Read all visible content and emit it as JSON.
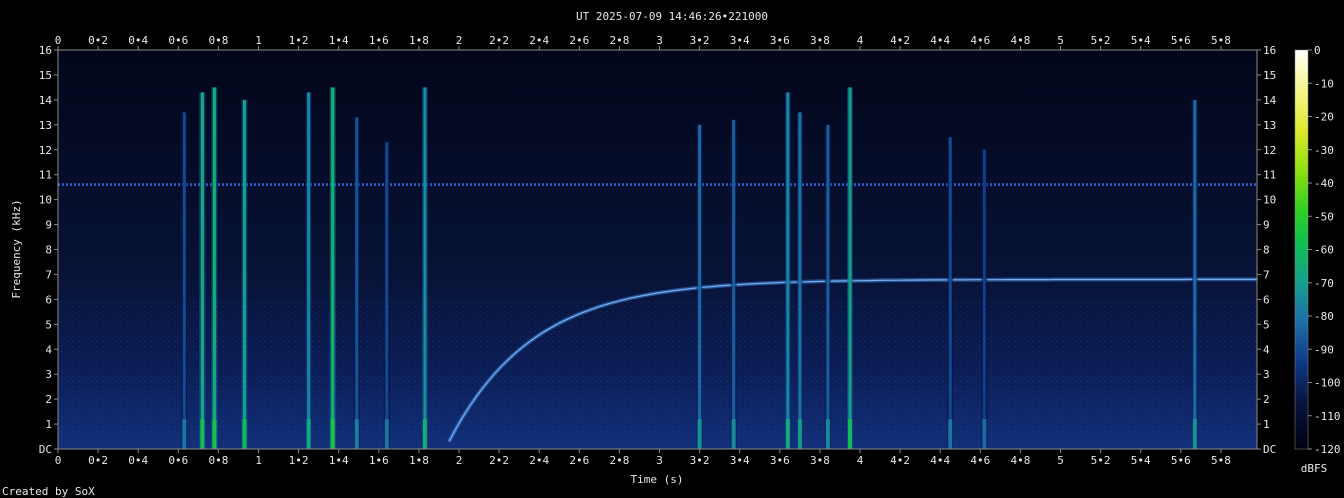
{
  "chart_data": {
    "type": "heatmap",
    "title": "UT 2025-07-09 14:46:26•221000",
    "xlabel": "Time (s)",
    "ylabel": "Frequency (kHz)",
    "xlim": [
      0,
      5.98
    ],
    "ylim": [
      0,
      16
    ],
    "x_ticks": [
      "0",
      "0•2",
      "0•4",
      "0•6",
      "0•8",
      "1",
      "1•2",
      "1•4",
      "1•6",
      "1•8",
      "2",
      "2•2",
      "2•4",
      "2•6",
      "2•8",
      "3",
      "3•2",
      "3•4",
      "3•6",
      "3•8",
      "4",
      "4•2",
      "4•4",
      "4•6",
      "4•8",
      "5",
      "5•2",
      "5•4",
      "5•6",
      "5•8"
    ],
    "y_ticks": [
      "DC",
      "1",
      "2",
      "3",
      "4",
      "5",
      "6",
      "7",
      "8",
      "9",
      "10",
      "11",
      "12",
      "13",
      "14",
      "15",
      "16"
    ],
    "colorbar": {
      "label": "dBFS",
      "ticks": [
        "0",
        "-10",
        "-20",
        "-30",
        "-40",
        "-50",
        "-60",
        "-70",
        "-80",
        "-90",
        "-100",
        "-110",
        "-120"
      ],
      "range": [
        -120,
        0
      ]
    },
    "features": {
      "tone_khz": 10.6,
      "sweep": {
        "start_s": 1.95,
        "end_s": 5.98,
        "start_khz": 0.3,
        "end_khz": 6.8
      },
      "clicks": [
        {
          "t": 0.63,
          "top_khz": 13.5,
          "level": -92
        },
        {
          "t": 0.72,
          "top_khz": 14.3,
          "level": -72
        },
        {
          "t": 0.78,
          "top_khz": 14.5,
          "level": -70
        },
        {
          "t": 0.93,
          "top_khz": 14.0,
          "level": -74
        },
        {
          "t": 1.25,
          "top_khz": 14.3,
          "level": -80
        },
        {
          "t": 1.37,
          "top_khz": 14.5,
          "level": -68
        },
        {
          "t": 1.49,
          "top_khz": 13.3,
          "level": -90
        },
        {
          "t": 1.64,
          "top_khz": 12.3,
          "level": -92
        },
        {
          "t": 1.83,
          "top_khz": 14.5,
          "level": -78
        },
        {
          "t": 3.2,
          "top_khz": 13.0,
          "level": -86
        },
        {
          "t": 3.37,
          "top_khz": 13.2,
          "level": -88
        },
        {
          "t": 3.64,
          "top_khz": 14.3,
          "level": -80
        },
        {
          "t": 3.7,
          "top_khz": 13.5,
          "level": -84
        },
        {
          "t": 3.84,
          "top_khz": 13.0,
          "level": -88
        },
        {
          "t": 3.95,
          "top_khz": 14.5,
          "level": -74
        },
        {
          "t": 4.45,
          "top_khz": 12.5,
          "level": -92
        },
        {
          "t": 4.62,
          "top_khz": 12.0,
          "level": -94
        },
        {
          "t": 5.67,
          "top_khz": 14.0,
          "level": -86
        }
      ]
    }
  },
  "footer": {
    "credit": "Created by SoX"
  }
}
